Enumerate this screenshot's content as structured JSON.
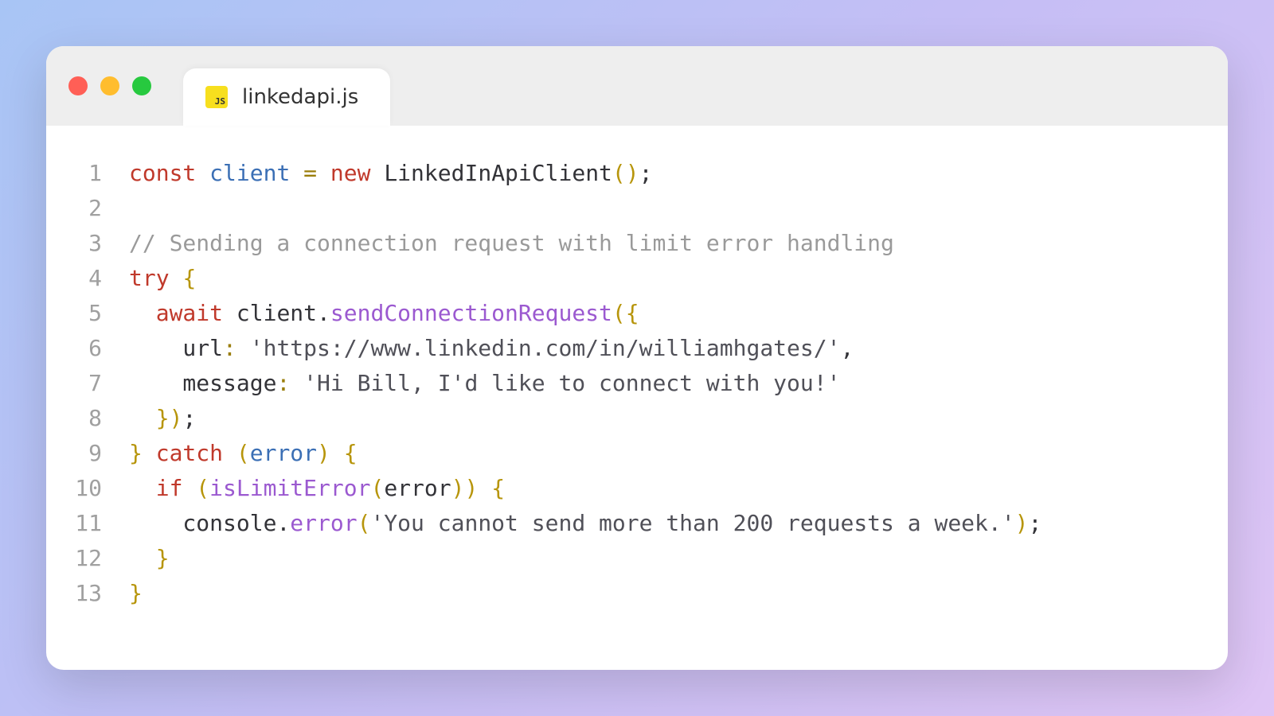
{
  "tab": {
    "filename": "linkedapi.js",
    "icon_text": "JS"
  },
  "code": {
    "lines": [
      [
        {
          "t": "const ",
          "c": "tok-kw"
        },
        {
          "t": "client",
          "c": "tok-ident"
        },
        {
          "t": " = ",
          "c": "tok-op"
        },
        {
          "t": "new ",
          "c": "tok-kw"
        },
        {
          "t": "LinkedInApiClient",
          "c": ""
        },
        {
          "t": "()",
          "c": "tok-paren"
        },
        {
          "t": ";",
          "c": ""
        }
      ],
      [],
      [
        {
          "t": "// Sending a connection request with limit error handling",
          "c": "tok-comment"
        }
      ],
      [
        {
          "t": "try",
          "c": "tok-kw"
        },
        {
          "t": " ",
          "c": ""
        },
        {
          "t": "{",
          "c": "tok-paren"
        }
      ],
      [
        {
          "t": "  ",
          "c": ""
        },
        {
          "t": "await",
          "c": "tok-kw"
        },
        {
          "t": " client",
          "c": ""
        },
        {
          "t": ".",
          "c": ""
        },
        {
          "t": "sendConnectionRequest",
          "c": "tok-fn"
        },
        {
          "t": "({",
          "c": "tok-paren"
        }
      ],
      [
        {
          "t": "    url",
          "c": ""
        },
        {
          "t": ":",
          "c": "tok-op"
        },
        {
          "t": " ",
          "c": ""
        },
        {
          "t": "'https://www.linkedin.com/in/williamhgates/'",
          "c": "tok-str"
        },
        {
          "t": ",",
          "c": ""
        }
      ],
      [
        {
          "t": "    message",
          "c": ""
        },
        {
          "t": ":",
          "c": "tok-op"
        },
        {
          "t": " ",
          "c": ""
        },
        {
          "t": "'Hi Bill, I'd like to connect with you!'",
          "c": "tok-str"
        }
      ],
      [
        {
          "t": "  ",
          "c": ""
        },
        {
          "t": "})",
          "c": "tok-paren"
        },
        {
          "t": ";",
          "c": ""
        }
      ],
      [
        {
          "t": "}",
          "c": "tok-paren"
        },
        {
          "t": " ",
          "c": ""
        },
        {
          "t": "catch",
          "c": "tok-kw"
        },
        {
          "t": " ",
          "c": ""
        },
        {
          "t": "(",
          "c": "tok-paren"
        },
        {
          "t": "error",
          "c": "tok-ident"
        },
        {
          "t": ")",
          "c": "tok-paren"
        },
        {
          "t": " ",
          "c": ""
        },
        {
          "t": "{",
          "c": "tok-paren"
        }
      ],
      [
        {
          "t": "  ",
          "c": ""
        },
        {
          "t": "if",
          "c": "tok-kw"
        },
        {
          "t": " ",
          "c": ""
        },
        {
          "t": "(",
          "c": "tok-paren"
        },
        {
          "t": "isLimitError",
          "c": "tok-fn"
        },
        {
          "t": "(",
          "c": "tok-paren"
        },
        {
          "t": "error",
          "c": ""
        },
        {
          "t": "))",
          "c": "tok-paren"
        },
        {
          "t": " ",
          "c": ""
        },
        {
          "t": "{",
          "c": "tok-paren"
        }
      ],
      [
        {
          "t": "    console",
          "c": ""
        },
        {
          "t": ".",
          "c": ""
        },
        {
          "t": "error",
          "c": "tok-fn"
        },
        {
          "t": "(",
          "c": "tok-paren"
        },
        {
          "t": "'You cannot send more than 200 requests a week.'",
          "c": "tok-str"
        },
        {
          "t": ")",
          "c": "tok-paren"
        },
        {
          "t": ";",
          "c": ""
        }
      ],
      [
        {
          "t": "  ",
          "c": ""
        },
        {
          "t": "}",
          "c": "tok-paren"
        }
      ],
      [
        {
          "t": "}",
          "c": "tok-paren"
        }
      ]
    ]
  }
}
